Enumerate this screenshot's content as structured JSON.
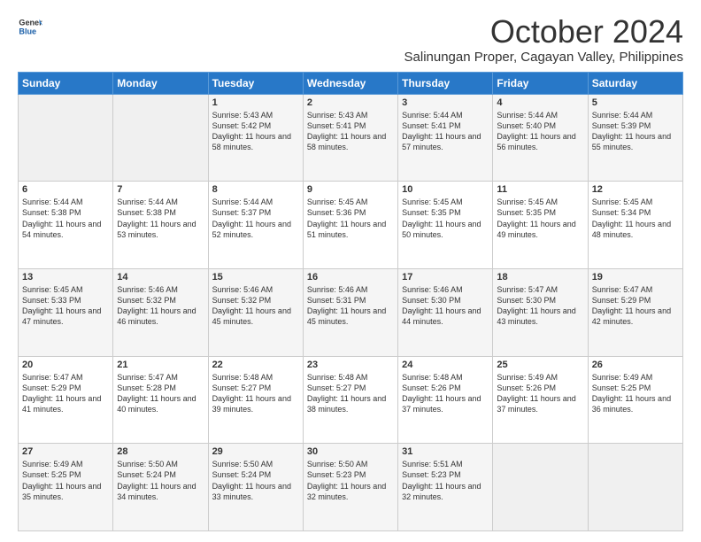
{
  "header": {
    "logo_line1": "General",
    "logo_line2": "Blue",
    "month_title": "October 2024",
    "location": "Salinungan Proper, Cagayan Valley, Philippines"
  },
  "days_of_week": [
    "Sunday",
    "Monday",
    "Tuesday",
    "Wednesday",
    "Thursday",
    "Friday",
    "Saturday"
  ],
  "weeks": [
    [
      {
        "day": "",
        "empty": true
      },
      {
        "day": "",
        "empty": true
      },
      {
        "day": "1",
        "sunrise": "5:43 AM",
        "sunset": "5:42 PM",
        "daylight": "11 hours and 58 minutes."
      },
      {
        "day": "2",
        "sunrise": "5:43 AM",
        "sunset": "5:41 PM",
        "daylight": "11 hours and 58 minutes."
      },
      {
        "day": "3",
        "sunrise": "5:44 AM",
        "sunset": "5:41 PM",
        "daylight": "11 hours and 57 minutes."
      },
      {
        "day": "4",
        "sunrise": "5:44 AM",
        "sunset": "5:40 PM",
        "daylight": "11 hours and 56 minutes."
      },
      {
        "day": "5",
        "sunrise": "5:44 AM",
        "sunset": "5:39 PM",
        "daylight": "11 hours and 55 minutes."
      }
    ],
    [
      {
        "day": "6",
        "sunrise": "5:44 AM",
        "sunset": "5:38 PM",
        "daylight": "11 hours and 54 minutes."
      },
      {
        "day": "7",
        "sunrise": "5:44 AM",
        "sunset": "5:38 PM",
        "daylight": "11 hours and 53 minutes."
      },
      {
        "day": "8",
        "sunrise": "5:44 AM",
        "sunset": "5:37 PM",
        "daylight": "11 hours and 52 minutes."
      },
      {
        "day": "9",
        "sunrise": "5:45 AM",
        "sunset": "5:36 PM",
        "daylight": "11 hours and 51 minutes."
      },
      {
        "day": "10",
        "sunrise": "5:45 AM",
        "sunset": "5:35 PM",
        "daylight": "11 hours and 50 minutes."
      },
      {
        "day": "11",
        "sunrise": "5:45 AM",
        "sunset": "5:35 PM",
        "daylight": "11 hours and 49 minutes."
      },
      {
        "day": "12",
        "sunrise": "5:45 AM",
        "sunset": "5:34 PM",
        "daylight": "11 hours and 48 minutes."
      }
    ],
    [
      {
        "day": "13",
        "sunrise": "5:45 AM",
        "sunset": "5:33 PM",
        "daylight": "11 hours and 47 minutes."
      },
      {
        "day": "14",
        "sunrise": "5:46 AM",
        "sunset": "5:32 PM",
        "daylight": "11 hours and 46 minutes."
      },
      {
        "day": "15",
        "sunrise": "5:46 AM",
        "sunset": "5:32 PM",
        "daylight": "11 hours and 45 minutes."
      },
      {
        "day": "16",
        "sunrise": "5:46 AM",
        "sunset": "5:31 PM",
        "daylight": "11 hours and 45 minutes."
      },
      {
        "day": "17",
        "sunrise": "5:46 AM",
        "sunset": "5:30 PM",
        "daylight": "11 hours and 44 minutes."
      },
      {
        "day": "18",
        "sunrise": "5:47 AM",
        "sunset": "5:30 PM",
        "daylight": "11 hours and 43 minutes."
      },
      {
        "day": "19",
        "sunrise": "5:47 AM",
        "sunset": "5:29 PM",
        "daylight": "11 hours and 42 minutes."
      }
    ],
    [
      {
        "day": "20",
        "sunrise": "5:47 AM",
        "sunset": "5:29 PM",
        "daylight": "11 hours and 41 minutes."
      },
      {
        "day": "21",
        "sunrise": "5:47 AM",
        "sunset": "5:28 PM",
        "daylight": "11 hours and 40 minutes."
      },
      {
        "day": "22",
        "sunrise": "5:48 AM",
        "sunset": "5:27 PM",
        "daylight": "11 hours and 39 minutes."
      },
      {
        "day": "23",
        "sunrise": "5:48 AM",
        "sunset": "5:27 PM",
        "daylight": "11 hours and 38 minutes."
      },
      {
        "day": "24",
        "sunrise": "5:48 AM",
        "sunset": "5:26 PM",
        "daylight": "11 hours and 37 minutes."
      },
      {
        "day": "25",
        "sunrise": "5:49 AM",
        "sunset": "5:26 PM",
        "daylight": "11 hours and 37 minutes."
      },
      {
        "day": "26",
        "sunrise": "5:49 AM",
        "sunset": "5:25 PM",
        "daylight": "11 hours and 36 minutes."
      }
    ],
    [
      {
        "day": "27",
        "sunrise": "5:49 AM",
        "sunset": "5:25 PM",
        "daylight": "11 hours and 35 minutes."
      },
      {
        "day": "28",
        "sunrise": "5:50 AM",
        "sunset": "5:24 PM",
        "daylight": "11 hours and 34 minutes."
      },
      {
        "day": "29",
        "sunrise": "5:50 AM",
        "sunset": "5:24 PM",
        "daylight": "11 hours and 33 minutes."
      },
      {
        "day": "30",
        "sunrise": "5:50 AM",
        "sunset": "5:23 PM",
        "daylight": "11 hours and 32 minutes."
      },
      {
        "day": "31",
        "sunrise": "5:51 AM",
        "sunset": "5:23 PM",
        "daylight": "11 hours and 32 minutes."
      },
      {
        "day": "",
        "empty": true
      },
      {
        "day": "",
        "empty": true
      }
    ]
  ]
}
